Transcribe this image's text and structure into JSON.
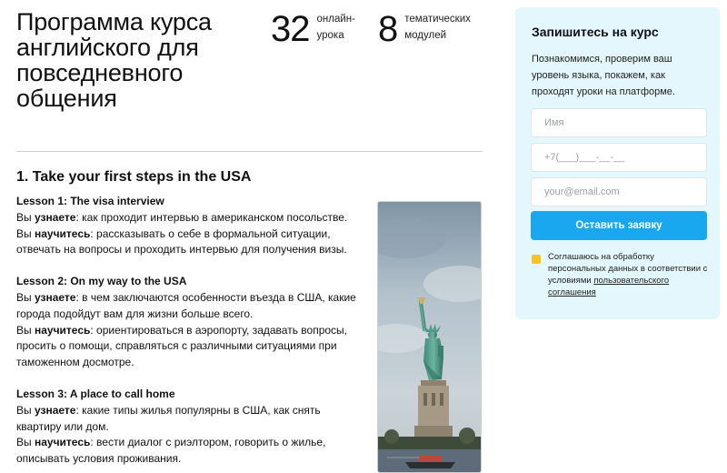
{
  "header": {
    "title": "Программа курса английского для повседневного общения",
    "stats": [
      {
        "number": "32",
        "label": "онлайн-\nурока"
      },
      {
        "number": "8",
        "label": "тематических\nмодулей"
      }
    ]
  },
  "module": {
    "title": "1. Take your first steps in the USA",
    "lessons": [
      {
        "title": "Lesson 1: The visa interview",
        "learn_kw": "узнаете",
        "learn_text": "как проходит интервью в американском посольстве.",
        "skill_kw": "научитесь",
        "skill_text": "рассказывать о себе в формальной ситуации, отвечать на вопросы и проходить интервью для получения визы."
      },
      {
        "title": "Lesson 2: On my way to the USA",
        "learn_kw": "узнаете",
        "learn_text": "в чем заключаются особенности въезда в США, какие города подойдут вам для жизни больше всего.",
        "skill_kw": "научитесь",
        "skill_text": "ориентироваться в аэропорту, задавать вопросы, просить о помощи, справляться с различными ситуациями при таможенном досмотре."
      },
      {
        "title": "Lesson 3: A place to call home",
        "learn_kw": "узнаете",
        "learn_text": "какие типы жилья популярны в США, как снять квартиру или дом.",
        "skill_kw": "научитесь",
        "skill_text": "вести диалог с риэлтором, говорить о жилье, описывать условия проживания."
      }
    ],
    "prefix_you": "Вы"
  },
  "form": {
    "title": "Запишитесь на курс",
    "description": "Познакомимся, проверим ваш уровень языка, покажем, как проходят уроки на платформе.",
    "name_placeholder": "Имя",
    "phone_placeholder": "+7(___)___-__-__",
    "email_placeholder": "your@email.com",
    "submit_label": "Оставить заявку",
    "consent_text": "Соглашаюсь на обработку персональных данных в соответствии с условиями",
    "consent_link": "пользовательского соглашения"
  },
  "colors": {
    "accent": "#19a8f0",
    "card_bg": "#e3f7fd",
    "checkbox": "#f8c320"
  }
}
